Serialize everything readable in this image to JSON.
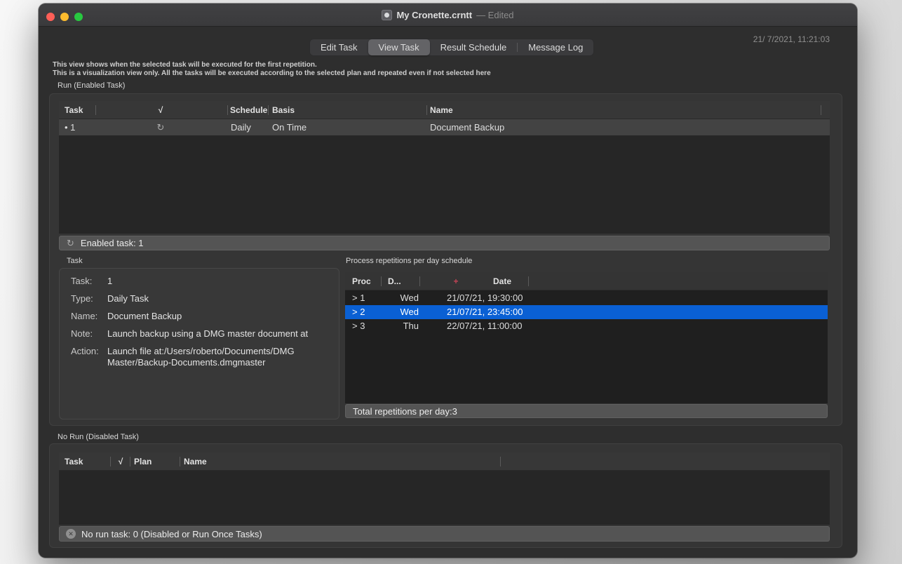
{
  "titlebar": {
    "title": "My Cronette.crntt",
    "edited": "—  Edited"
  },
  "tabs": {
    "items": [
      "Edit Task",
      "View Task",
      "Result Schedule",
      "Message Log"
    ],
    "active": "View Task"
  },
  "timestamp": "21/ 7/2021, 11:21:03",
  "intro": {
    "line1": "This view shows when the selected task will be executed for the first repetition.",
    "line2": "This is a visualization view only. All the tasks will be executed according to the selected plan and repeated even if not selected here"
  },
  "run_section": {
    "title": "Run (Enabled Task)",
    "headers": {
      "task": "Task",
      "check": "√",
      "schedule": "Schedule",
      "basis": "Basis",
      "name": "Name"
    },
    "row": {
      "task": "• 1",
      "check": "↻",
      "schedule": "Daily",
      "basis": "On Time",
      "name": "Document Backup"
    },
    "status": {
      "icon": "↻",
      "text": "Enabled task: 1"
    }
  },
  "task_panel": {
    "title": "Task",
    "fields": [
      {
        "label": "Task:",
        "value": "1"
      },
      {
        "label": "Type:",
        "value": "Daily Task"
      },
      {
        "label": "Name:",
        "value": "Document Backup"
      },
      {
        "label": "Note:",
        "value": "Launch backup using a DMG master document at"
      },
      {
        "label": "Action:",
        "value": "Launch file at:/Users/roberto/Documents/DMG Master/Backup-Documents.dmgmaster"
      }
    ]
  },
  "repetition_panel": {
    "title": "Process repetitions per day schedule",
    "headers": {
      "proc": "Proc",
      "day": "D...",
      "plus": "+",
      "date": "Date"
    },
    "rows": [
      {
        "proc": "> 1",
        "day": "Wed",
        "date": "21/07/21, 19:30:00"
      },
      {
        "proc": "> 2",
        "day": "Wed",
        "date": "21/07/21, 23:45:00"
      },
      {
        "proc": "> 3",
        "day": "Thu",
        "date": "22/07/21, 11:00:00"
      }
    ],
    "selected_index": 1,
    "status": "Total repetitions per day:3"
  },
  "norun_section": {
    "title": "No Run (Disabled Task)",
    "headers": {
      "task": "Task",
      "check": "√",
      "plan": "Plan",
      "name": "Name"
    },
    "status": {
      "icon": "✕",
      "text": "No run task: 0 (Disabled or Run Once Tasks)"
    }
  },
  "colors": {
    "selection_blue": "#0a60d4",
    "plus_red": "#c24355",
    "traffic_red": "#ff5f57",
    "traffic_yellow": "#febc2e",
    "traffic_green": "#28c840"
  }
}
